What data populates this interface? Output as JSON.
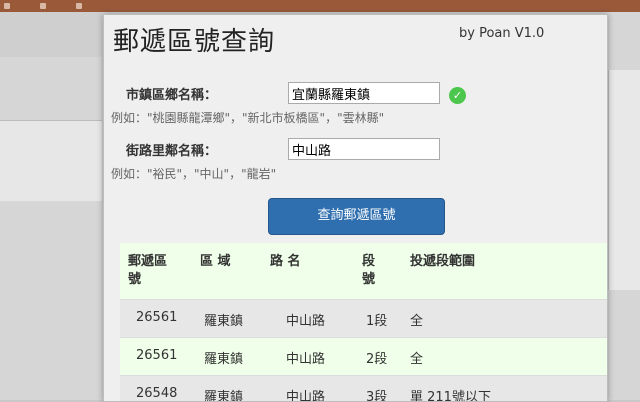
{
  "app": {
    "title": "郵遞區號查詢",
    "version": "by Poan V1.0"
  },
  "form": {
    "town_label": "市鎮區鄉名稱：",
    "town_value": "宜蘭縣羅東鎮",
    "town_hint": "例如：\"桃園縣龍潭鄉\"，\"新北市板橋區\"，\"雲林縣\"",
    "road_label": "街路里鄰名稱：",
    "road_value": "中山路",
    "road_hint": "例如：\"裕民\"，\"中山\"，\"龍岩\"",
    "submit_label": "查詢郵遞區號",
    "check_icon": "check-circle-icon",
    "check_color": "#4cc64c"
  },
  "table": {
    "headers": [
      "郵遞區號",
      "區 域",
      "路 名",
      "段號",
      "投遞段範圍"
    ],
    "rows": [
      [
        "26561",
        "羅東鎮",
        "中山路",
        "1段",
        "全"
      ],
      [
        "26561",
        "羅東鎮",
        "中山路",
        "2段",
        "全"
      ],
      [
        "26548",
        "羅東鎮",
        "中山路",
        "3段",
        "單 211號以下"
      ]
    ]
  },
  "colors": {
    "button": "#2f6faf",
    "header_bg": "#efffe9",
    "stripe_bg": "#e7e7e7"
  }
}
